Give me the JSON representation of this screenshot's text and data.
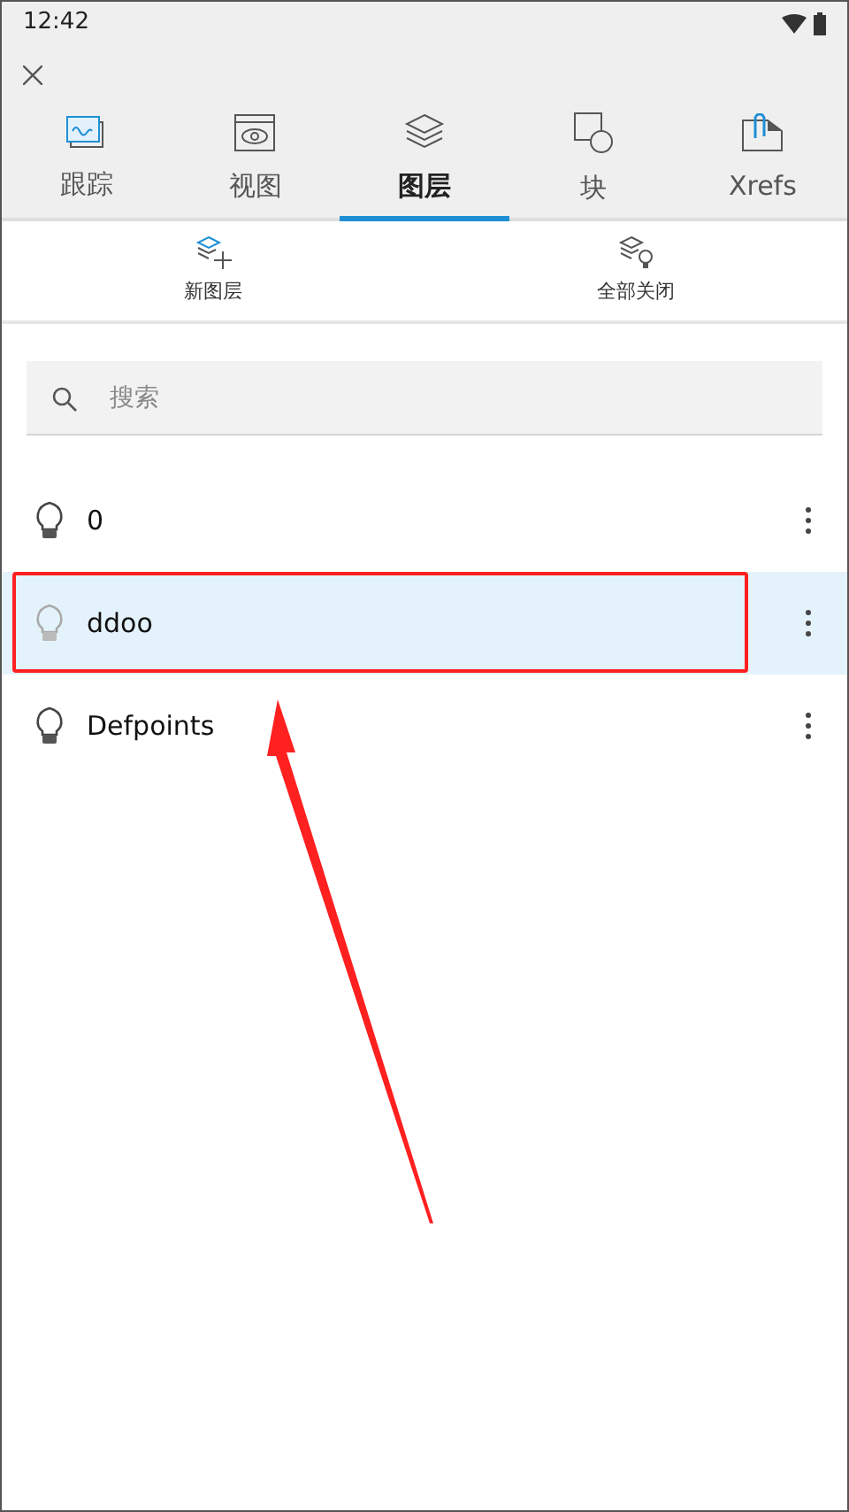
{
  "status_bar": {
    "time": "12:42"
  },
  "tabs": [
    {
      "label": "跟踪",
      "kind": "trace",
      "selected": false
    },
    {
      "label": "视图",
      "kind": "view",
      "selected": false
    },
    {
      "label": "图层",
      "kind": "layers",
      "selected": true
    },
    {
      "label": "块",
      "kind": "block",
      "selected": false
    },
    {
      "label": "Xrefs",
      "kind": "xref",
      "selected": false
    }
  ],
  "actions": [
    {
      "label": "新图层",
      "kind": "new"
    },
    {
      "label": "全部关闭",
      "kind": "off"
    }
  ],
  "search": {
    "placeholder": "搜索"
  },
  "layers": [
    {
      "name": "0",
      "on": true,
      "selected": false,
      "annotated": false
    },
    {
      "name": "ddoo",
      "on": false,
      "selected": true,
      "annotated": true
    },
    {
      "name": "Defpoints",
      "on": true,
      "selected": false,
      "annotated": false
    }
  ]
}
